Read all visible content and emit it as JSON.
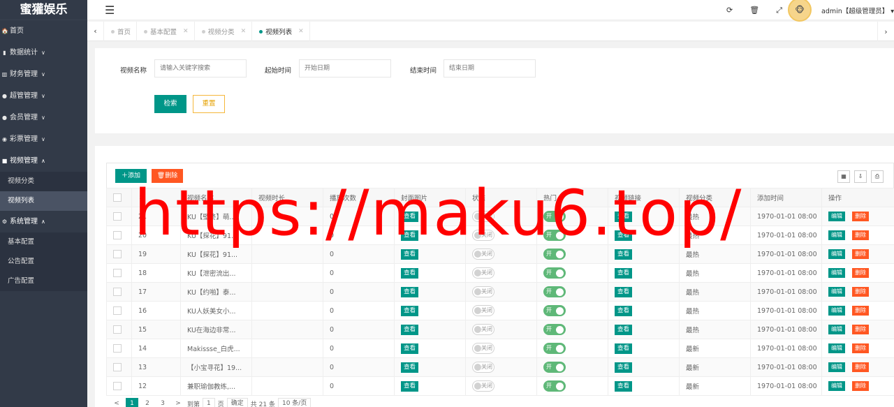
{
  "app": {
    "logo": "蜜獾娱乐"
  },
  "sidebar": {
    "items": [
      {
        "icon": "home-icon",
        "glyph": "🏠",
        "label": "首页",
        "arrow": ""
      },
      {
        "icon": "bar-chart-icon",
        "glyph": "▮",
        "label": "数据统计",
        "arrow": "∨"
      },
      {
        "icon": "bank-icon",
        "glyph": "▥",
        "label": "财务管理",
        "arrow": "∨"
      },
      {
        "icon": "user-icon",
        "glyph": "●",
        "label": "超管管理",
        "arrow": "∨"
      },
      {
        "icon": "users-icon",
        "glyph": "●",
        "label": "会员管理",
        "arrow": "∨"
      },
      {
        "icon": "gamepad-icon",
        "glyph": "◉",
        "label": "彩票管理",
        "arrow": "∨"
      },
      {
        "icon": "video-icon",
        "glyph": "■",
        "label": "视频管理",
        "arrow": "∧"
      }
    ],
    "video_sub": [
      "视频分类",
      "视频列表"
    ],
    "system": {
      "label": "系统管理",
      "arrow": "∧"
    },
    "system_sub": [
      "基本配置",
      "公告配置",
      "广告配置"
    ]
  },
  "topbar": {
    "user": "admin【超级管理员】",
    "icons": [
      "refresh-icon",
      "trash-icon",
      "fullscreen-icon"
    ]
  },
  "tabs": [
    {
      "label": "首页",
      "closable": false
    },
    {
      "label": "基本配置",
      "closable": true
    },
    {
      "label": "视频分类",
      "closable": true
    },
    {
      "label": "视频列表",
      "closable": true,
      "active": true
    }
  ],
  "search": {
    "name_label": "视频名称",
    "name_placeholder": "请输入关键字搜索",
    "start_label": "起始时间",
    "start_placeholder": "开始日期",
    "end_label": "结束时间",
    "end_placeholder": "结束日期",
    "search_btn": "检索",
    "reset_btn": "重置"
  },
  "toolbar": {
    "add": "添加",
    "delete": "删除"
  },
  "table": {
    "headers": [
      "",
      "⇕",
      "视频名称",
      "视频时长",
      "播放次数",
      "封面图片",
      "状态",
      "热门",
      "视频链接",
      "视频分类",
      "添加时间",
      "操作"
    ],
    "view_label": "查看",
    "off_label": "关闭",
    "on_label": "开",
    "edit_label": "编辑",
    "del_label": "删除",
    "rows": [
      {
        "id": "21",
        "name": "KU【壁咚】萌...",
        "plays": "0",
        "category": "最热",
        "time": "1970-01-01 08:00"
      },
      {
        "id": "20",
        "name": "KU【探花】91...",
        "plays": "0",
        "category": "最热",
        "time": "1970-01-01 08:00"
      },
      {
        "id": "19",
        "name": "KU【探花】91...",
        "plays": "0",
        "category": "最热",
        "time": "1970-01-01 08:00"
      },
      {
        "id": "18",
        "name": "KU【泄密流出...",
        "plays": "0",
        "category": "最热",
        "time": "1970-01-01 08:00"
      },
      {
        "id": "17",
        "name": "KU【约啪】泰...",
        "plays": "0",
        "category": "最热",
        "time": "1970-01-01 08:00"
      },
      {
        "id": "16",
        "name": "KU人妖美女小...",
        "plays": "0",
        "category": "最热",
        "time": "1970-01-01 08:00"
      },
      {
        "id": "15",
        "name": "KU在海边非常...",
        "plays": "0",
        "category": "最热",
        "time": "1970-01-01 08:00"
      },
      {
        "id": "14",
        "name": "Makissse_白虎...",
        "plays": "0",
        "category": "最新",
        "time": "1970-01-01 08:00"
      },
      {
        "id": "13",
        "name": "【小宝寻花】19...",
        "plays": "0",
        "category": "最新",
        "time": "1970-01-01 08:00"
      },
      {
        "id": "12",
        "name": "兼职瑜伽教练,...",
        "plays": "0",
        "category": "最新",
        "time": "1970-01-01 08:00"
      }
    ]
  },
  "pager": {
    "prev": "<",
    "pages": [
      "1",
      "2",
      "3"
    ],
    "next": ">",
    "goto": "到第",
    "page_value": "1",
    "page_unit": "页",
    "confirm": "确定",
    "total": "共 21 条",
    "size": "10 条/页"
  },
  "watermark": "https://maku6.top/"
}
